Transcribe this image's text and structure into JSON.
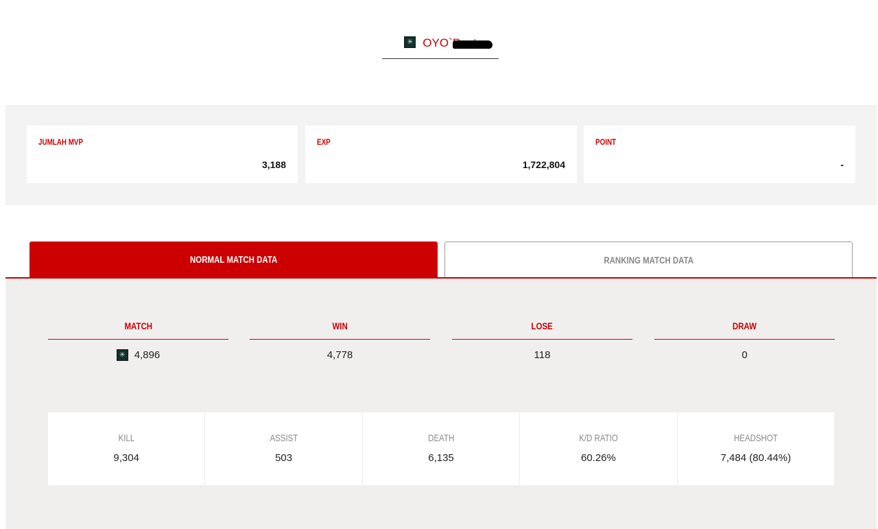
{
  "player": {
    "name": "OYO`Pent",
    "rank_icon": "rank-badge-icon"
  },
  "summary": [
    {
      "label": "JUMLAH MVP",
      "value": "3,188"
    },
    {
      "label": "EXP",
      "value": "1,722,804"
    },
    {
      "label": "POINT",
      "value": "-"
    }
  ],
  "tabs": [
    {
      "label": "NORMAL MATCH DATA",
      "active": true
    },
    {
      "label": "RANKING MATCH DATA",
      "active": false
    }
  ],
  "match": [
    {
      "label": "MATCH",
      "value": "4,896"
    },
    {
      "label": "WIN",
      "value": "4,778"
    },
    {
      "label": "LOSE",
      "value": "118"
    },
    {
      "label": "DRAW",
      "value": "0"
    }
  ],
  "stats": [
    {
      "label": "KILL",
      "value": "9,304"
    },
    {
      "label": "ASSIST",
      "value": "503"
    },
    {
      "label": "DEATH",
      "value": "6,135"
    },
    {
      "label": "K/D RATIO",
      "value": "60.26%"
    },
    {
      "label": "HEADSHOT",
      "value": "7,484 (80.44%)"
    }
  ],
  "colors": {
    "accent": "#cc0000",
    "panel": "#f3f3f3",
    "content_bg": "#f0efee"
  }
}
